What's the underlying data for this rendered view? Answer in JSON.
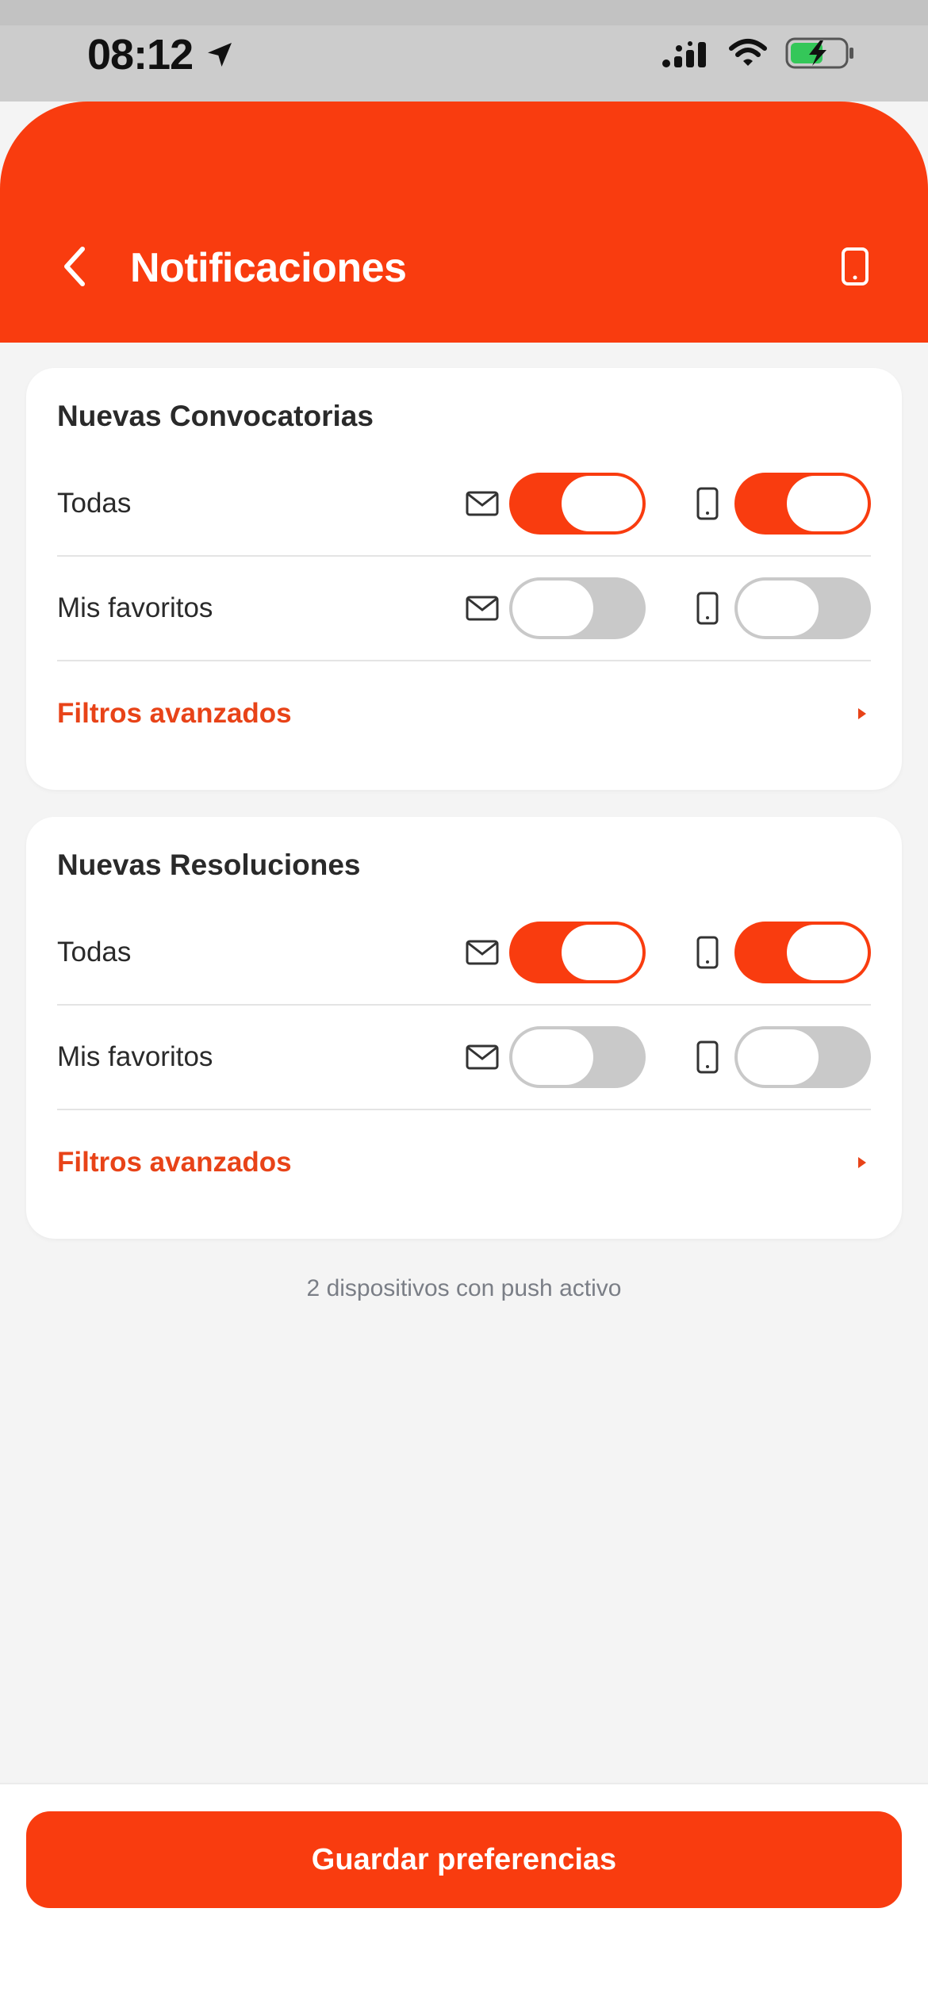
{
  "status_bar": {
    "time": "08:12",
    "icons": [
      "location-arrow-icon",
      "signal-icon",
      "wifi-icon",
      "battery-charging-icon"
    ]
  },
  "header": {
    "title": "Notificaciones",
    "back_icon": "chevron-left-icon",
    "device_icon": "phone-icon"
  },
  "sections": [
    {
      "title": "Nuevas Convocatorias",
      "rows": [
        {
          "label": "Todas",
          "email_enabled": true,
          "push_enabled": true
        },
        {
          "label": "Mis favoritos",
          "email_enabled": false,
          "push_enabled": false
        }
      ],
      "filters_label": "Filtros avanzados"
    },
    {
      "title": "Nuevas Resoluciones",
      "rows": [
        {
          "label": "Todas",
          "email_enabled": true,
          "push_enabled": true
        },
        {
          "label": "Mis favoritos",
          "email_enabled": false,
          "push_enabled": false
        }
      ],
      "filters_label": "Filtros avanzados"
    }
  ],
  "push_info": "2 dispositivos con push activo",
  "footer": {
    "save_label": "Guardar preferencias"
  },
  "colors": {
    "accent": "#f93c0f",
    "link": "#e84318",
    "toggle_off": "#c9c9c9",
    "background": "#f4f4f4"
  }
}
